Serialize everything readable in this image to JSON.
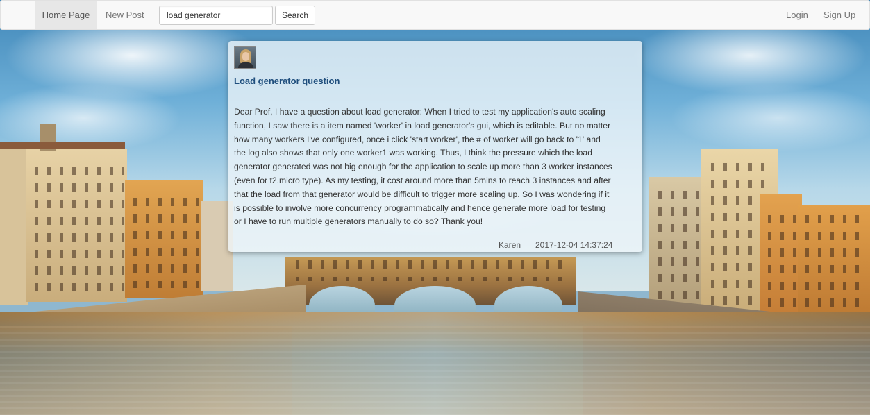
{
  "navbar": {
    "home_label": "Home Page",
    "new_post_label": "New Post",
    "search_value": "load generator",
    "search_button_label": "Search",
    "login_label": "Login",
    "signup_label": "Sign Up"
  },
  "post": {
    "title": "Load generator question",
    "body": "Dear Prof, I have a question about load generator: When I tried to test my application's auto scaling function, I saw there is a item named 'worker' in load generator's gui, which is editable. But no matter how many workers I've configured, once i click 'start worker', the # of worker will go back to '1' and the log also shows that only one worker1 was working. Thus, I think the pressure which the load generator generated was not big enough for the application to scale up more than 3 worker instances (even for t2.micro type). As my testing, it cost around more than 5mins to reach 3 instances and after that the load from that generator would be difficult to trigger more scaling up. So I was wondering if it is possible to involve more concurrency programmatically and hence generate more load for testing or I have to run multiple generators manually to do so? Thank you!",
    "author": "Karen",
    "timestamp": "2017-12-04 14:37:24"
  },
  "colors": {
    "title": "#1f4e7d",
    "navbar_bg": "#f8f8f8",
    "active_nav_bg": "#e7e7e7"
  }
}
